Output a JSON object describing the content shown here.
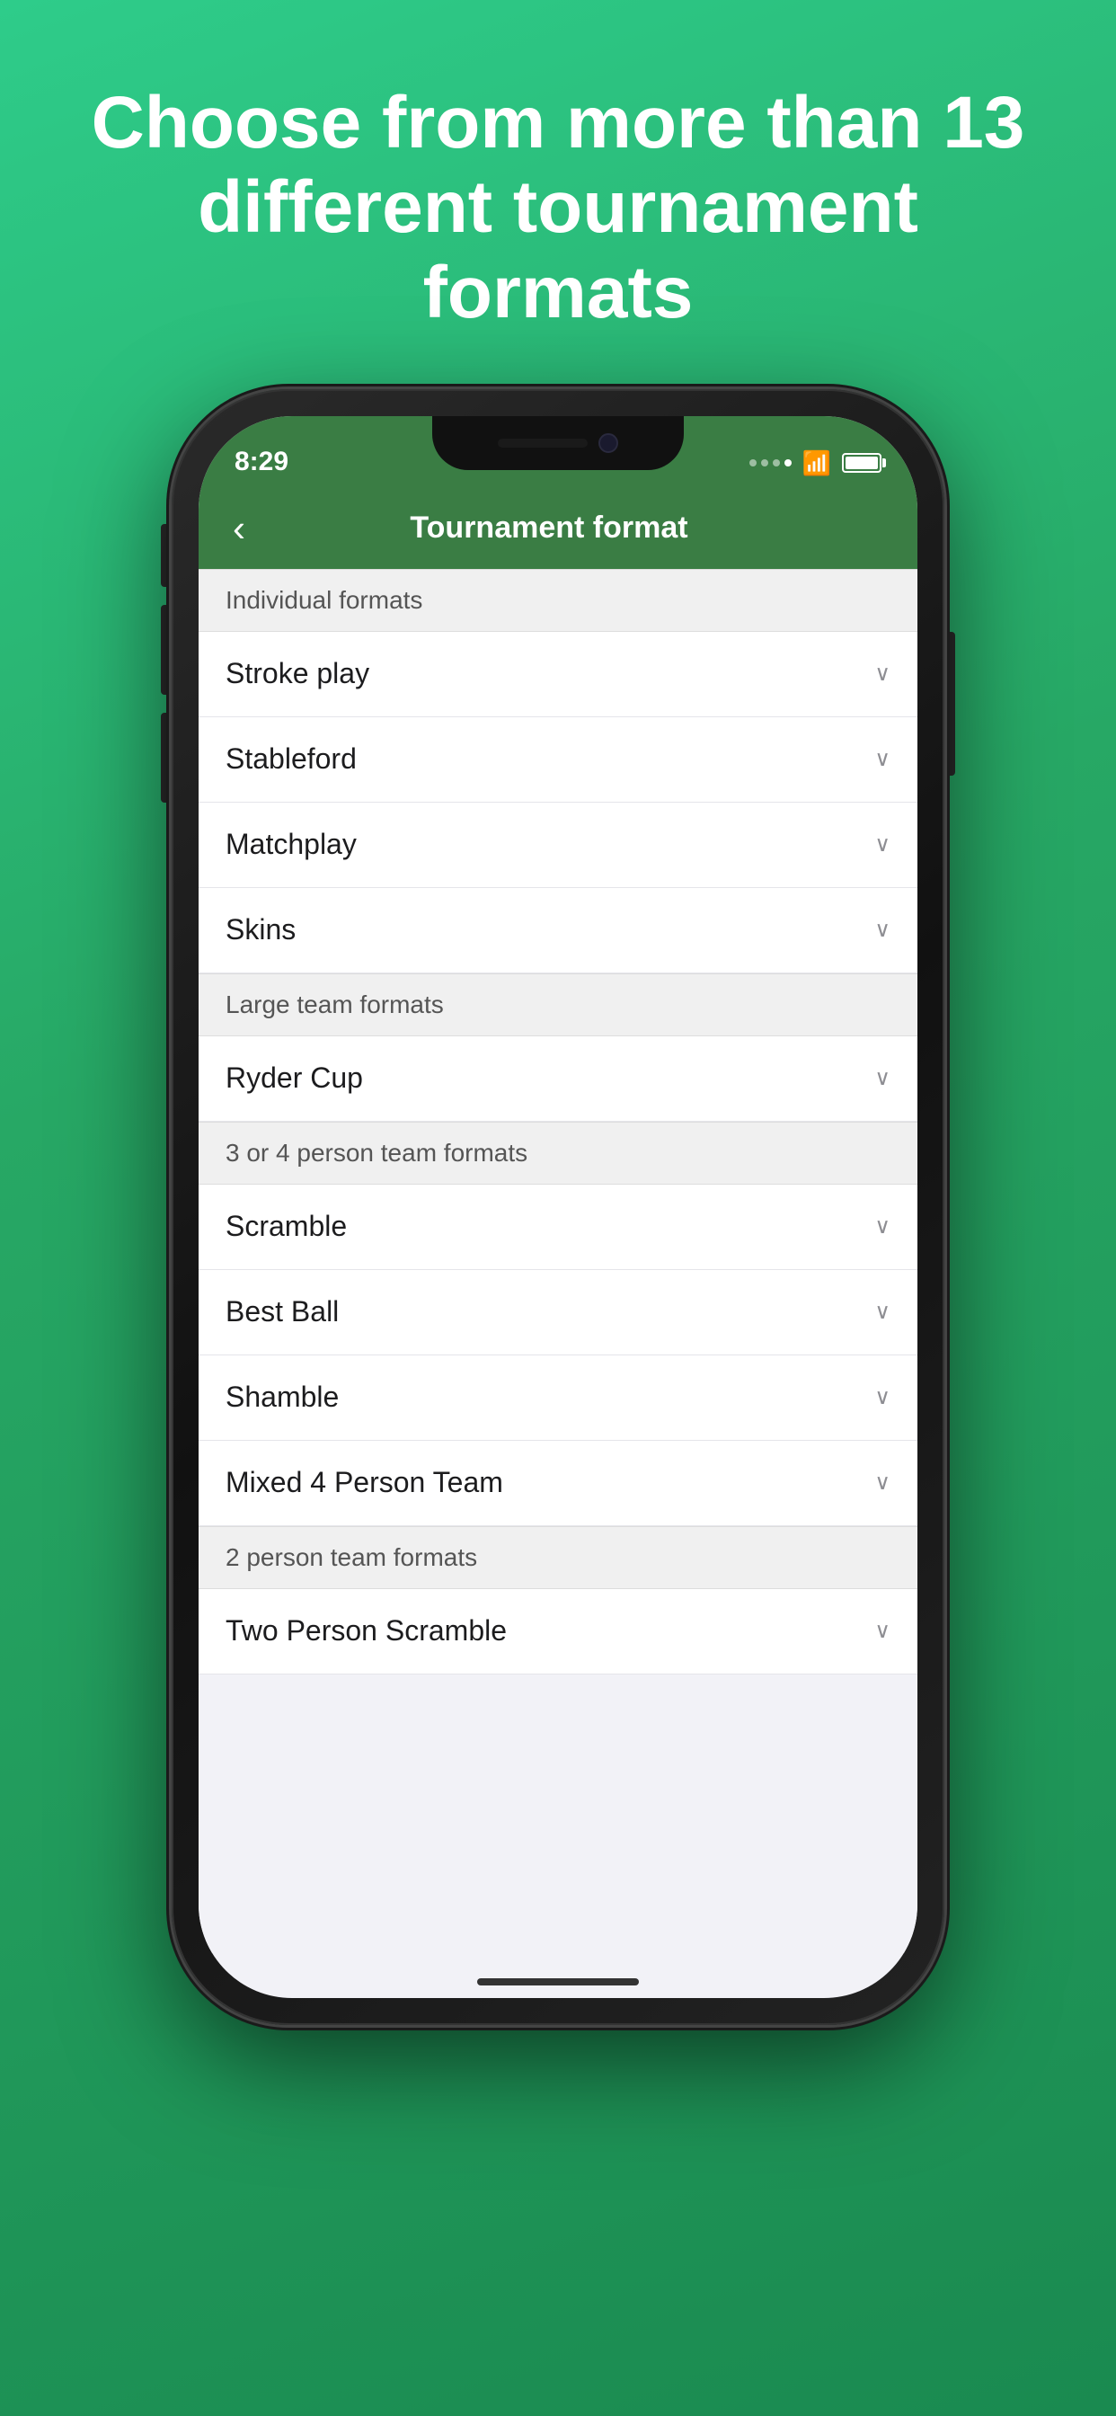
{
  "background": {
    "gradient_start": "#2ecc8a",
    "gradient_end": "#1a8a50"
  },
  "hero": {
    "title": "Choose from more than 13 different tournament formats"
  },
  "status_bar": {
    "time": "8:29"
  },
  "nav": {
    "title": "Tournament format",
    "back_label": "‹"
  },
  "sections": [
    {
      "header": "Individual formats",
      "items": [
        {
          "label": "Stroke play"
        },
        {
          "label": "Stableford"
        },
        {
          "label": "Matchplay"
        },
        {
          "label": "Skins"
        }
      ]
    },
    {
      "header": "Large team formats",
      "items": [
        {
          "label": "Ryder Cup"
        }
      ]
    },
    {
      "header": "3 or 4 person team formats",
      "items": [
        {
          "label": "Scramble"
        },
        {
          "label": "Best Ball"
        },
        {
          "label": "Shamble"
        },
        {
          "label": "Mixed 4 Person Team"
        }
      ]
    },
    {
      "header": "2 person team formats",
      "items": [
        {
          "label": "Two Person Scramble"
        }
      ]
    }
  ],
  "chevron_char": "⌄"
}
